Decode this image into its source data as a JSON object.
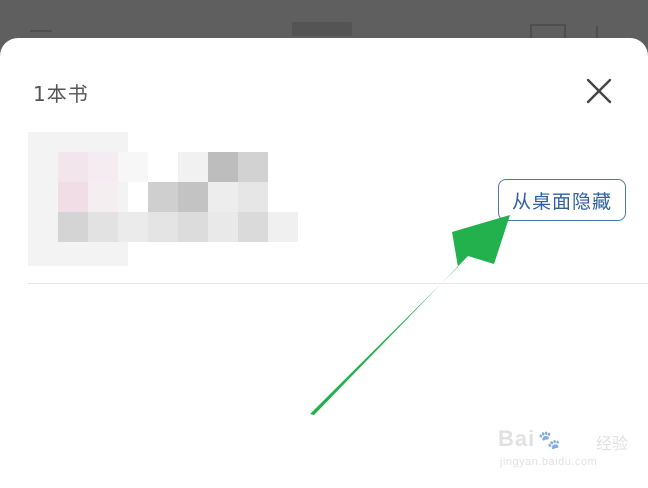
{
  "sheet": {
    "title": "1本书",
    "close_icon": "close-icon"
  },
  "book": {
    "hide_button_label": "从桌面隐藏"
  },
  "watermark": {
    "brand": "Bai",
    "paw": "🐾",
    "sub": "经验",
    "url": "jingyan.baidu.com"
  },
  "colors": {
    "accent": "#2f5f9e",
    "arrow": "#22b14c",
    "overlay": "#5f5f5f"
  }
}
